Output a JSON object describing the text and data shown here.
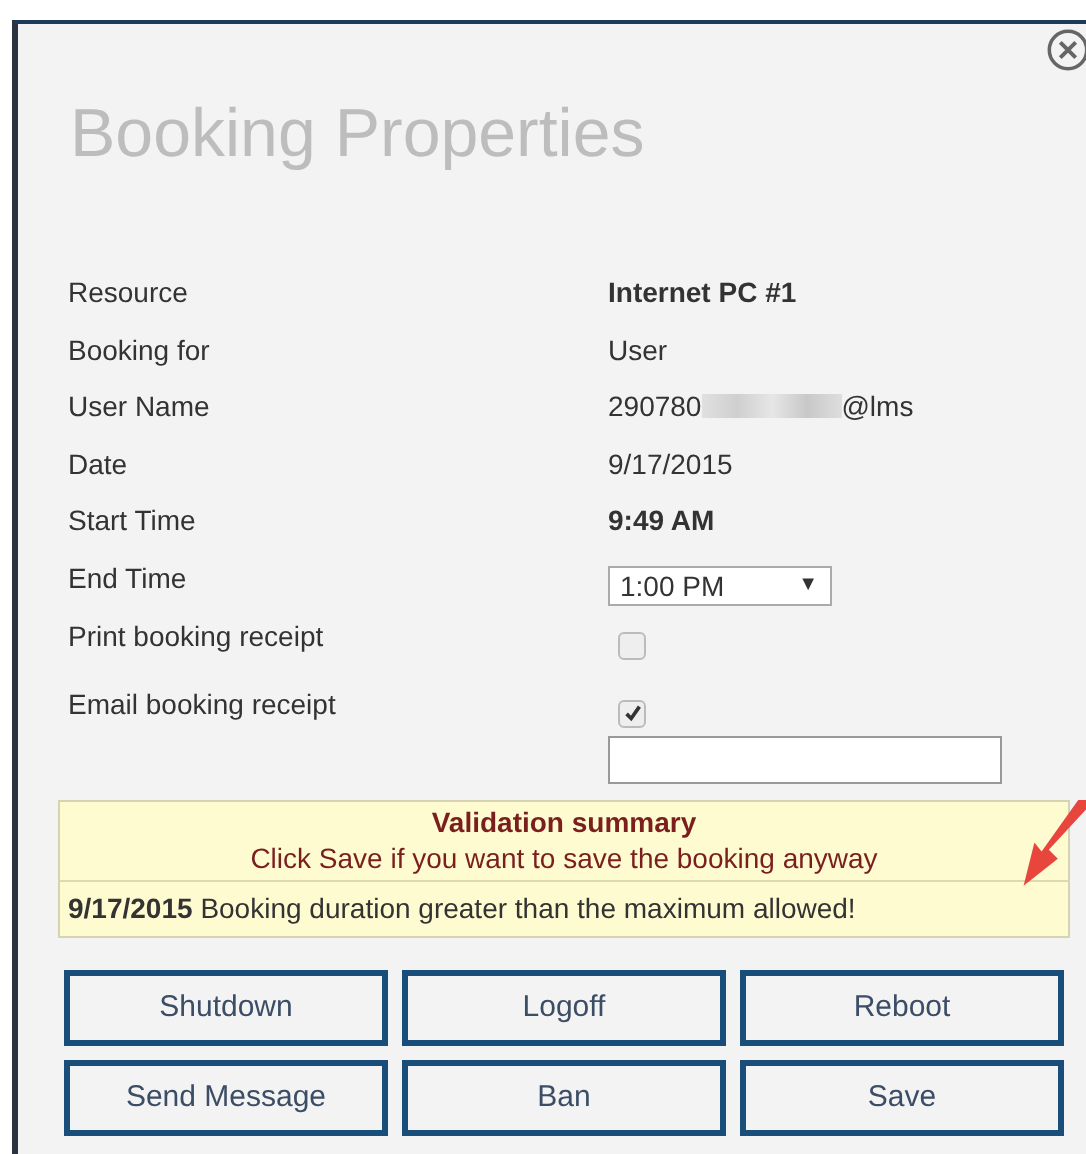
{
  "dialog": {
    "title": "Booking Properties"
  },
  "fields": [
    {
      "kind": "text",
      "label": "Resource",
      "value": "Internet PC #1",
      "bold": true
    },
    {
      "kind": "text",
      "label": "Booking for",
      "value": "User",
      "bold": false
    },
    {
      "kind": "redacted",
      "label": "User Name",
      "value": "290780",
      "suffix": "@lms"
    },
    {
      "kind": "text",
      "label": "Date",
      "value": "9/17/2015",
      "bold": false
    },
    {
      "kind": "text",
      "label": "Start Time",
      "value": "9:49 AM",
      "bold": true
    },
    {
      "kind": "select",
      "label": "End Time",
      "value": "1:00 PM",
      "caret": "▼"
    },
    {
      "kind": "checkbox",
      "label": "Print booking receipt",
      "checked": false
    },
    {
      "kind": "checkbox-input",
      "label": "Email booking receipt",
      "checked": true
    }
  ],
  "validation": {
    "title": "Validation summary",
    "subtitle": "Click Save if you want to save the booking anyway",
    "date": "9/17/2015",
    "message": "Booking duration greater than the maximum allowed!"
  },
  "buttons": [
    "Shutdown",
    "Logoff",
    "Reboot",
    "Send Message",
    "Ban",
    "Save"
  ]
}
